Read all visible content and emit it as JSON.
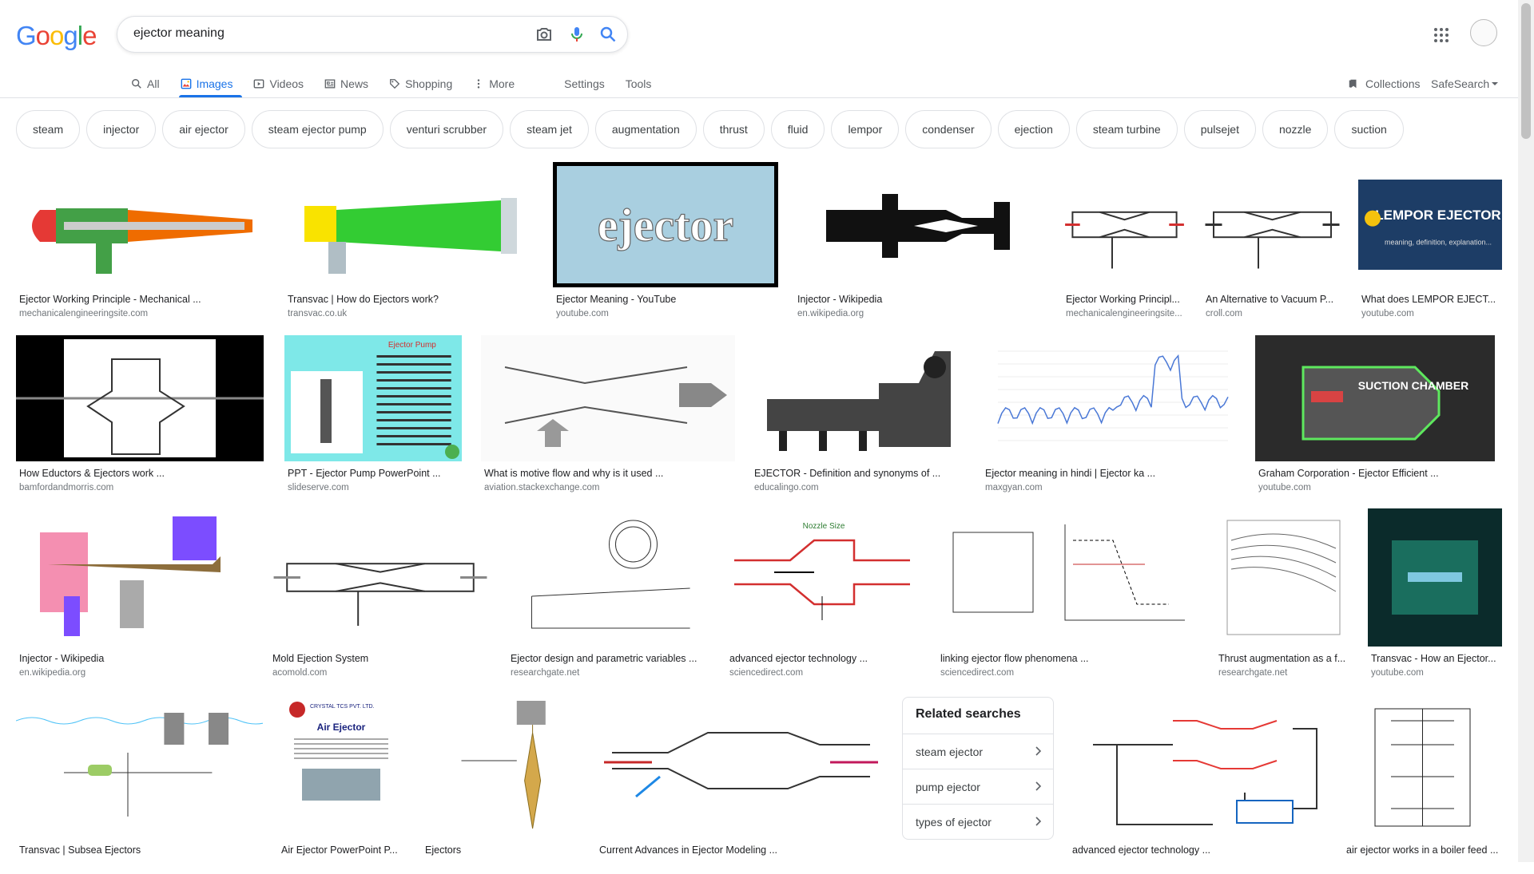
{
  "logo": {
    "text": "Google",
    "letter_colors": [
      "#4285f4",
      "#ea4335",
      "#fbbc05",
      "#4285f4",
      "#34a853",
      "#ea4335"
    ]
  },
  "search": {
    "query": "ejector meaning",
    "icons": [
      "camera-icon",
      "mic-icon",
      "search-icon"
    ]
  },
  "tabs": [
    {
      "label": "All",
      "icon": "search-icon",
      "active": false
    },
    {
      "label": "Images",
      "icon": "image-icon",
      "active": true
    },
    {
      "label": "Videos",
      "icon": "video-icon",
      "active": false
    },
    {
      "label": "News",
      "icon": "news-icon",
      "active": false
    },
    {
      "label": "Shopping",
      "icon": "tag-icon",
      "active": false
    },
    {
      "label": "More",
      "icon": "more-icon",
      "active": false
    }
  ],
  "tools": {
    "settings": "Settings",
    "tools": "Tools",
    "collections": "Collections",
    "safesearch": "SafeSearch"
  },
  "chips": [
    "steam",
    "injector",
    "air ejector",
    "steam ejector pump",
    "venturi scrubber",
    "steam jet",
    "augmentation",
    "thrust",
    "fluid",
    "lempor",
    "condenser",
    "ejection",
    "steam turbine",
    "pulsejet",
    "nozzle",
    "suction"
  ],
  "results": [
    {
      "title": "Ejector Working Principle - Mechanical ...",
      "source": "mechanicalengineeringsite.com"
    },
    {
      "title": "Transvac | How do Ejectors work?",
      "source": "transvac.co.uk"
    },
    {
      "title": "Ejector Meaning - YouTube",
      "source": "youtube.com",
      "thumb_text": "ejector"
    },
    {
      "title": "Injector - Wikipedia",
      "source": "en.wikipedia.org"
    },
    {
      "title": "Ejector Working Principl...",
      "source": "mechanicalengineeringsite..."
    },
    {
      "title": "An Alternative to Vacuum P...",
      "source": "croll.com"
    },
    {
      "title": "What does LEMPOR EJECT...",
      "source": "youtube.com",
      "thumb_text": "LEMPOR EJECTOR",
      "thumb_sub": "meaning, definition, explanation..."
    },
    {
      "title": "How Eductors & Ejectors work ...",
      "source": "bamfordandmorris.com"
    },
    {
      "title": "PPT - Ejector Pump PowerPoint ...",
      "source": "slideserve.com",
      "thumb_text": "Ejector Pump"
    },
    {
      "title": "What is motive flow and why is it used ...",
      "source": "aviation.stackexchange.com"
    },
    {
      "title": "EJECTOR - Definition and synonyms of ...",
      "source": "educalingo.com"
    },
    {
      "title": "Ejector meaning in hindi | Ejector ka ...",
      "source": "maxgyan.com"
    },
    {
      "title": "Graham Corporation - Ejector Efficient ...",
      "source": "youtube.com",
      "thumb_text": "SUCTION CHAMBER"
    },
    {
      "title": "Injector - Wikipedia",
      "source": "en.wikipedia.org"
    },
    {
      "title": "Mold Ejection System",
      "source": "acomold.com"
    },
    {
      "title": "Ejector design and parametric variables ...",
      "source": "researchgate.net"
    },
    {
      "title": "advanced ejector technology ...",
      "source": "sciencedirect.com",
      "thumb_text": "Nozzle Size"
    },
    {
      "title": "linking ejector flow phenomena ...",
      "source": "sciencedirect.com"
    },
    {
      "title": "Thrust augmentation as a f...",
      "source": "researchgate.net"
    },
    {
      "title": "Transvac - How an Ejector...",
      "source": "youtube.com"
    },
    {
      "title": "Transvac | Subsea Ejectors",
      "source": ""
    },
    {
      "title": "Air Ejector PowerPoint P...",
      "source": "",
      "thumb_text": "Air Ejector",
      "thumb_sub": "CRYSTAL TCS PVT. LTD."
    },
    {
      "title": "Ejectors",
      "source": ""
    },
    {
      "title": "Current Advances in Ejector Modeling ...",
      "source": ""
    },
    {
      "title": "advanced ejector technology ...",
      "source": ""
    },
    {
      "title": "air ejector works in a boiler feed ...",
      "source": ""
    }
  ],
  "related": {
    "heading": "Related searches",
    "items": [
      "steam ejector",
      "pump ejector",
      "types of ejector"
    ]
  }
}
